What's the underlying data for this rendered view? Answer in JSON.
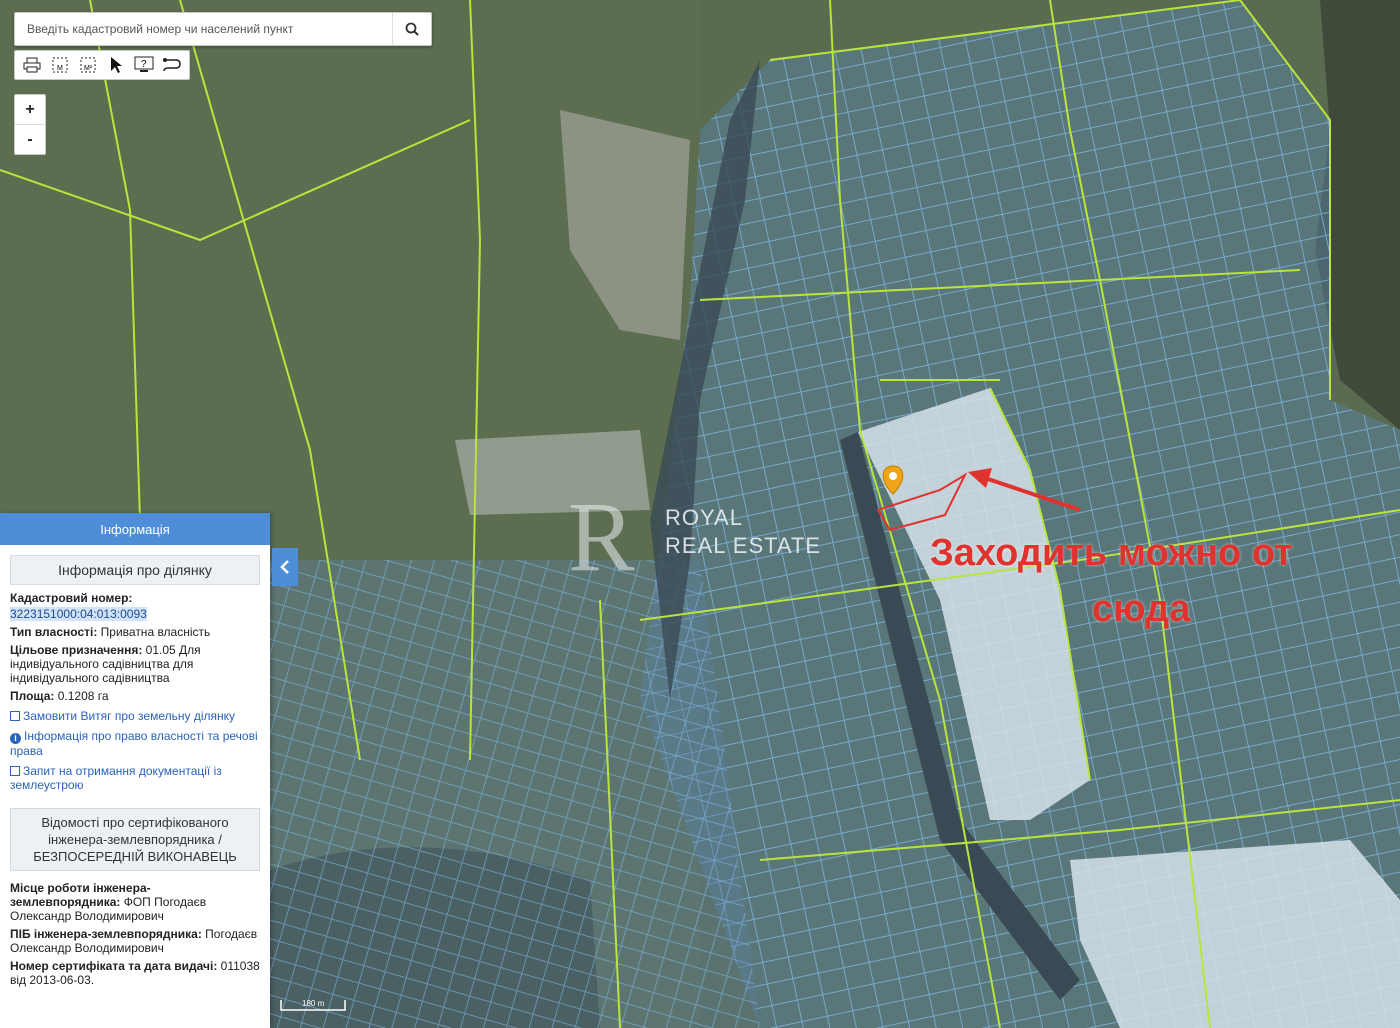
{
  "search": {
    "placeholder": "Введіть кадастровий номер чи населений пункт"
  },
  "toolbar": {
    "tools": [
      "print-icon",
      "measure-length-icon",
      "measure-area-icon",
      "pointer-icon",
      "info-icon",
      "route-icon"
    ]
  },
  "zoom": {
    "in_label": "+",
    "out_label": "-"
  },
  "panel": {
    "header": "Інформація",
    "section1_title": "Інформація про ділянку",
    "cadastral_label": "Кадастровий номер:",
    "cadastral_value": "3223151000:04:013:0093",
    "ownership_label": "Тип власності:",
    "ownership_value": " Приватна власність",
    "purpose_label": "Цільове призначення:",
    "purpose_value": " 01.05 Для індивідуального садівництва для індивідуального садівництва",
    "area_label": "Площа:",
    "area_value": " 0.1208 га",
    "link1": "Замовити Витяг про земельну ділянку",
    "link2": "Інформація про право власності та речові права",
    "link3": "Запит на отримання документації із землеустрою",
    "section2_title": "Відомості про сертифікованого інженера-землевпорядника / БЕЗПОСЕРЕДНІЙ ВИКОНАВЕЦЬ",
    "workplace_label": "Місце роботи інженера-землевпорядника:",
    "workplace_value": " ФОП Погодаєв Олександр Володимирович",
    "name_label": "ПІБ інженера-землевпорядника:",
    "name_value": " Погодаєв Олександр Володимирович",
    "cert_label": "Номер сертифіката та дата видачі:",
    "cert_value": " 011038 від 2013-06-03."
  },
  "scale_label": "180 m",
  "watermark": {
    "line1": "ROYAL",
    "line2": "REAL ESTATE",
    "mark": "R"
  },
  "annotation": {
    "line1": "Заходить можно от",
    "line2": "сюда"
  },
  "colors": {
    "accent": "#4e8ed9",
    "annotation": "#e0332e",
    "parcel_line": "#7fb4e0",
    "boundary_line": "#b9e43c"
  }
}
